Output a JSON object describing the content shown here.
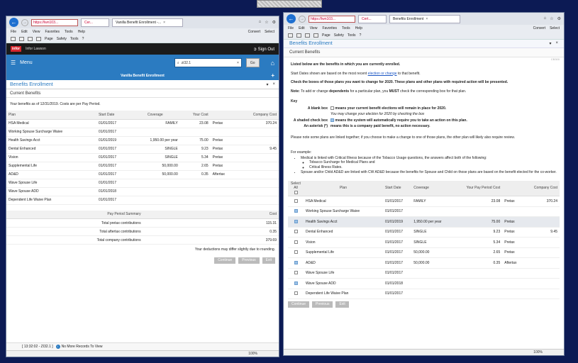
{
  "left_window": {
    "address": "https://lwn103...",
    "tab_title": "Vanilla Benefit Enrollment -...",
    "menus": [
      "File",
      "Edit",
      "View",
      "Favorites",
      "Tools",
      "Help"
    ],
    "convert": "Convert",
    "select": "Select",
    "page_menu": "Page",
    "safety_menu": "Safety",
    "tools_menu": "Tools",
    "app": {
      "logo": "infor",
      "product": "Infor Lawson",
      "sign_out": "Sign Out",
      "menu_label": "Menu",
      "search_value": "zi32.1",
      "go_label": "Go",
      "page_title": "Vanilla Benefit Enrollment",
      "section_title": "Benefits Enrollment",
      "subsection": "Current Benefits",
      "note": "Your benefits as of 12/31/2019. Costs are per Pay Period.",
      "headers": [
        "Plan",
        "Start Date",
        "Coverage",
        "Your Cost",
        "",
        "Company Cost"
      ],
      "rows": [
        [
          "HSA Medical",
          "01/01/2017",
          "FAMILY",
          "23.08",
          "Pretax",
          "370.24"
        ],
        [
          "Working Spouse Surcharge Waive",
          "01/01/2017",
          "",
          "",
          "",
          ""
        ],
        [
          "Health Savings Acct",
          "01/01/2019",
          "1,950.00 per year",
          "75.00",
          "Pretax",
          ""
        ],
        [
          "Dental Enhanced",
          "01/01/2017",
          "SINGLE",
          "9.23",
          "Pretax",
          "9.45"
        ],
        [
          "Vision",
          "01/01/2017",
          "SINGLE",
          "5.34",
          "Pretax",
          ""
        ],
        [
          "Supplemental Life",
          "01/01/2017",
          "50,000.00",
          "2.65",
          "Pretax",
          ""
        ],
        [
          "AD&D",
          "01/01/2017",
          "50,000.00",
          "0.35",
          "Aftertax",
          ""
        ],
        [
          "Wave Spouse Life",
          "01/01/2017",
          "",
          "",
          "",
          ""
        ],
        [
          "Wave Spouse ADD",
          "01/01/2018",
          "",
          "",
          "",
          ""
        ],
        [
          "Dependent Life Waive Plan",
          "01/01/2017",
          "",
          "",
          "",
          ""
        ]
      ],
      "summary_header": "Pay Period Summary",
      "summary_cost_header": "Cost",
      "summary": [
        [
          "Total pretax contributions",
          "115.31"
        ],
        [
          "Total aftertax contributions",
          "0.35"
        ],
        [
          "Total company contributions",
          "379.69"
        ]
      ],
      "deduction_note": "Your deductions may differ slightly due to rounding.",
      "buttons": [
        "Continue",
        "Previous",
        "Exit"
      ],
      "footer_left": "[ 13:32:02 - ZI32.1 ]",
      "footer_msg": "No More Records To View"
    },
    "zoom": "100%"
  },
  "right_window": {
    "address": "https://lwn103...",
    "tab_a": "Cert...",
    "tab_title": "Benefits Enrollment",
    "menus": [
      "File",
      "Edit",
      "View",
      "Favorites",
      "Tools",
      "Help"
    ],
    "convert": "Convert",
    "select": "Select",
    "page_menu": "Page",
    "safety_menu": "Safety",
    "tools_menu": "Tools",
    "section_title": "Benefits Enrollment",
    "subsection": "Current Benefits",
    "tiny_code": "CB300",
    "intro": "Listed below are the benefits in which you are currently enrolled.",
    "start_dates_a": "Start Dates shown are based on the most recent",
    "start_dates_link": "election or change",
    "start_dates_b": "to that benefit.",
    "check_boxes": "Check the boxes of those plans you want to change for 2020. These plans and other plans with required action will be presented.",
    "note_label": "Note:",
    "note_a": "To add or change",
    "note_bold": "dependents",
    "note_b": "for a particular plan, you",
    "note_must": "MUST",
    "note_c": "check the corresponding box for that plan.",
    "key_title": "Key",
    "key_blank_label": "A blank box",
    "key_blank_text": "means your current benefit elections will remain in place for 2020.",
    "key_blank_sub": "You may change your election for 2020 by checking the box",
    "key_shaded_label": "A shaded check box",
    "key_shaded_text": "means the system will automatically require you to take an action on this plan.",
    "key_asterisk_label": "An asterisk (*)",
    "key_asterisk_text": "means this is a company paid benefit, no action necessary.",
    "linked_note": "Please note some plans are linked together; if you choose to make a change to one of those plans, the other plan will likely also require review.",
    "example_title": "For example:",
    "example_1": "Medical is linked with Critical Illness because of the Tobacco Usage questions, the answers affect both of the following:",
    "example_1a": "Tobacco Surcharge for Medical Plans and",
    "example_1b": "Critical Illness Rates.",
    "example_2": "Spouse and/or Child AD&D are linked with CW AD&D because the benefits for Spouse and Child on those plans are based on the benefit elected for the co-worker.",
    "table": {
      "select_header": "Select",
      "all_label": "All",
      "headers": [
        "Plan",
        "Start Date",
        "Coverage",
        "Your Pay Period Cost",
        "",
        "Company Cost"
      ],
      "rows": [
        {
          "checked": false,
          "cells": [
            "HSA Medical",
            "01/01/2017",
            "FAMILY",
            "23.08",
            "Pretax",
            "370.24"
          ]
        },
        {
          "checked": true,
          "cells": [
            "Working Spouse Surcharge Waive",
            "01/01/2017",
            "",
            "",
            "",
            ""
          ]
        },
        {
          "checked": true,
          "cells": [
            "Health Savings Acct",
            "01/01/2019",
            "1,950.00 per year",
            "75.00",
            "Pretax",
            ""
          ]
        },
        {
          "checked": false,
          "cells": [
            "Dental Enhanced",
            "01/01/2017",
            "SINGLE",
            "9.23",
            "Pretax",
            "9.45"
          ]
        },
        {
          "checked": false,
          "cells": [
            "Vision",
            "01/01/2017",
            "SINGLE",
            "5.34",
            "Pretax",
            ""
          ]
        },
        {
          "checked": false,
          "cells": [
            "Supplemental Life",
            "01/01/2017",
            "50,000.00",
            "2.65",
            "Pretax",
            ""
          ]
        },
        {
          "checked": true,
          "cells": [
            "AD&D",
            "01/01/2017",
            "50,000.00",
            "0.35",
            "Aftertax",
            ""
          ]
        },
        {
          "checked": false,
          "cells": [
            "Wave Spouse Life",
            "01/01/2017",
            "",
            "",
            "",
            ""
          ]
        },
        {
          "checked": true,
          "cells": [
            "Wave Spouse ADD",
            "01/01/2018",
            "",
            "",
            "",
            ""
          ]
        },
        {
          "checked": false,
          "cells": [
            "Dependent Life Waive Plan",
            "01/01/2017",
            "",
            "",
            "",
            ""
          ]
        }
      ]
    },
    "buttons": [
      "Continue",
      "Previous",
      "Exit"
    ],
    "zoom": "100%"
  }
}
